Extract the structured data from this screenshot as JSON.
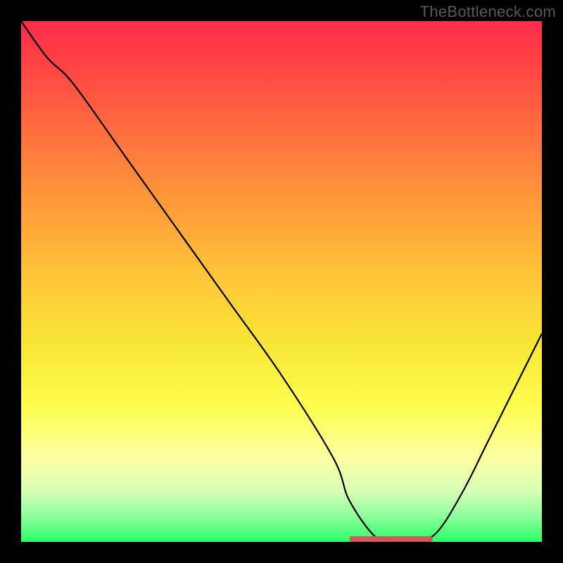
{
  "watermark": "TheBottleneck.com",
  "chart_data": {
    "type": "line",
    "title": "",
    "xlabel": "",
    "ylabel": "",
    "xlim": [
      0,
      100
    ],
    "ylim": [
      0,
      100
    ],
    "x": [
      0,
      5,
      10,
      20,
      30,
      40,
      50,
      60,
      63,
      68,
      72,
      76,
      80,
      85,
      90,
      100
    ],
    "values": [
      100,
      93,
      88,
      74,
      60,
      46,
      32,
      16,
      8,
      1,
      0,
      0,
      2,
      10,
      20,
      40
    ],
    "highlight_band": {
      "x_start": 63,
      "x_end": 79,
      "y": 0
    },
    "grid": false,
    "legend": false
  }
}
